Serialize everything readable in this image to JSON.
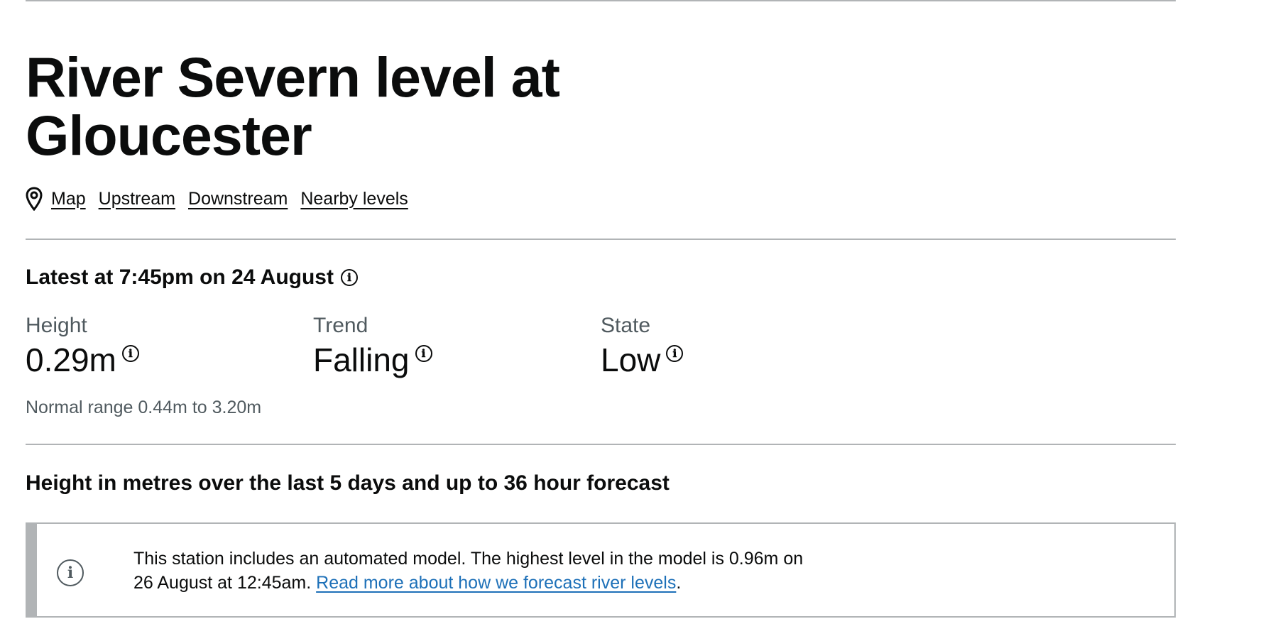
{
  "page": {
    "title": "River Severn level at Gloucester",
    "title_line1": "River Severn level at",
    "title_line2": "Gloucester"
  },
  "links": {
    "map": "Map",
    "upstream": "Upstream",
    "downstream": "Downstream",
    "nearby": "Nearby levels"
  },
  "latest": {
    "heading": "Latest at 7:45pm on 24 August",
    "height_label": "Height",
    "height_value": "0.29m",
    "trend_label": "Trend",
    "trend_value": "Falling",
    "state_label": "State",
    "state_value": "Low",
    "normal_range": "Normal range 0.44m to 3.20m"
  },
  "chart": {
    "heading": "Height in metres over the last 5 days and up to 36 hour forecast"
  },
  "notice": {
    "text": "This station includes an automated model. The highest level in the model is 0.96m on 26 August at 12:45am.",
    "link_text": "Read more about how we forecast river levels",
    "suffix": "."
  },
  "icons": {
    "info": "ℹ",
    "pin": "map-pin-icon"
  }
}
